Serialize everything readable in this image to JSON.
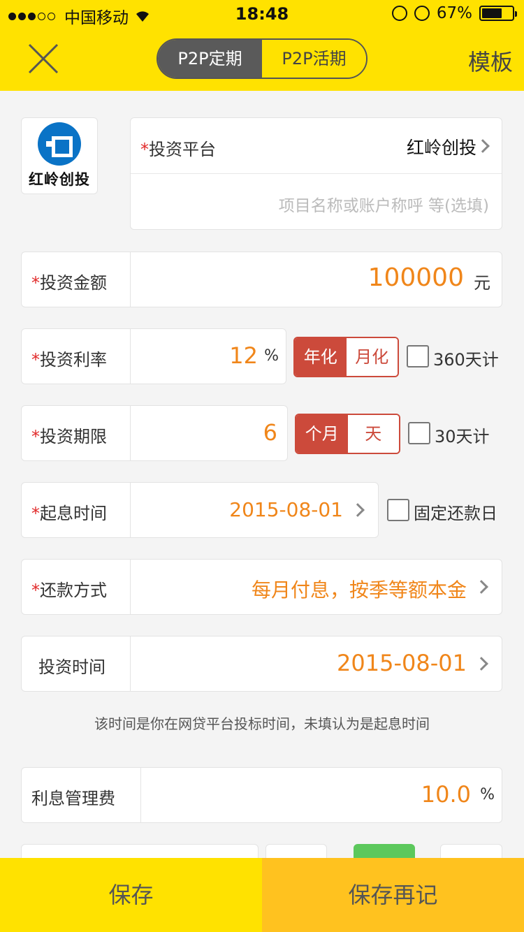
{
  "status_bar": {
    "carrier": "中国移动",
    "time": "18:48",
    "battery": "67%"
  },
  "header": {
    "tabs": [
      "P2P定期",
      "P2P活期"
    ],
    "active_tab": "P2P定期",
    "template_label": "模板"
  },
  "platform": {
    "logo_text": "红岭创投",
    "label": "投资平台",
    "value": "红岭创投",
    "project_placeholder": "项目名称或账户称呼 等(选填)"
  },
  "amount": {
    "label": "投资金额",
    "value": "100000",
    "unit": "元"
  },
  "rate": {
    "label": "投资利率",
    "value": "12",
    "unit": "%",
    "toggle": [
      "年化",
      "月化"
    ],
    "toggle_selected": "年化",
    "checkbox_label": "360天计"
  },
  "period": {
    "label": "投资期限",
    "value": "6",
    "toggle": [
      "个月",
      "天"
    ],
    "toggle_selected": "个月",
    "checkbox_label": "30天计"
  },
  "start_date": {
    "label": "起息时间",
    "value": "2015-08-01",
    "checkbox_label": "固定还款日"
  },
  "repayment": {
    "label": "还款方式",
    "value": "每月付息，按季等额本金"
  },
  "invest_time": {
    "label": "投资时间",
    "value": "2015-08-01"
  },
  "hint": "该时间是你在网贷平台投标时间，未填认为是起息时间",
  "fee": {
    "label": "利息管理费",
    "value": "10.0",
    "unit": "%"
  },
  "required_mark": "*",
  "footer": {
    "save": "保存",
    "save_again": "保存再记"
  },
  "colors": {
    "header_bg": "#ffe200",
    "accent_orange": "#f0861a",
    "toggle_red": "#cc4a3b",
    "save_again_bg": "#ffc21f"
  }
}
